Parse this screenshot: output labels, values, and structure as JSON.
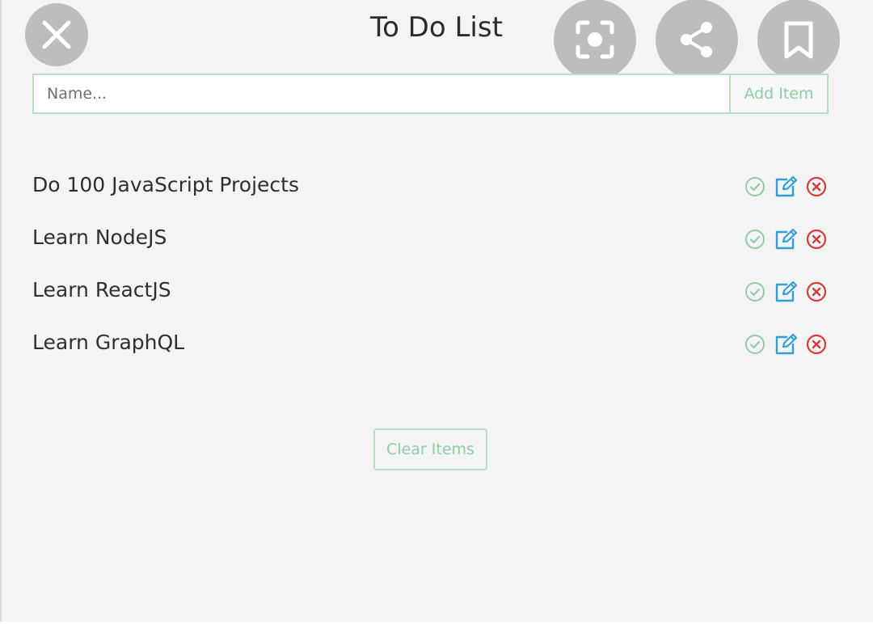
{
  "header": {
    "title": "To Do List"
  },
  "overlay": {
    "close_icon": "close-icon",
    "lens_icon": "lens-icon",
    "share_icon": "share-icon",
    "bookmark_icon": "bookmark-icon"
  },
  "form": {
    "name_placeholder": "Name...",
    "name_value": "",
    "add_button_label": "Add Item"
  },
  "todos": [
    {
      "text": "Do 100 JavaScript Projects"
    },
    {
      "text": "Learn NodeJS"
    },
    {
      "text": "Learn ReactJS"
    },
    {
      "text": "Learn GraphQL"
    }
  ],
  "item_actions": {
    "complete_icon": "check-circle-icon",
    "edit_icon": "edit-icon",
    "delete_icon": "delete-circle-icon"
  },
  "footer": {
    "clear_button_label": "Clear Items"
  },
  "colors": {
    "accent_green": "#8fcda5",
    "border_green": "#b8dcc5",
    "edit_blue": "#2f9fd6",
    "delete_red": "#d63a3a",
    "overlay_gray": "#bdbdbd",
    "background": "#f4f4f4"
  }
}
